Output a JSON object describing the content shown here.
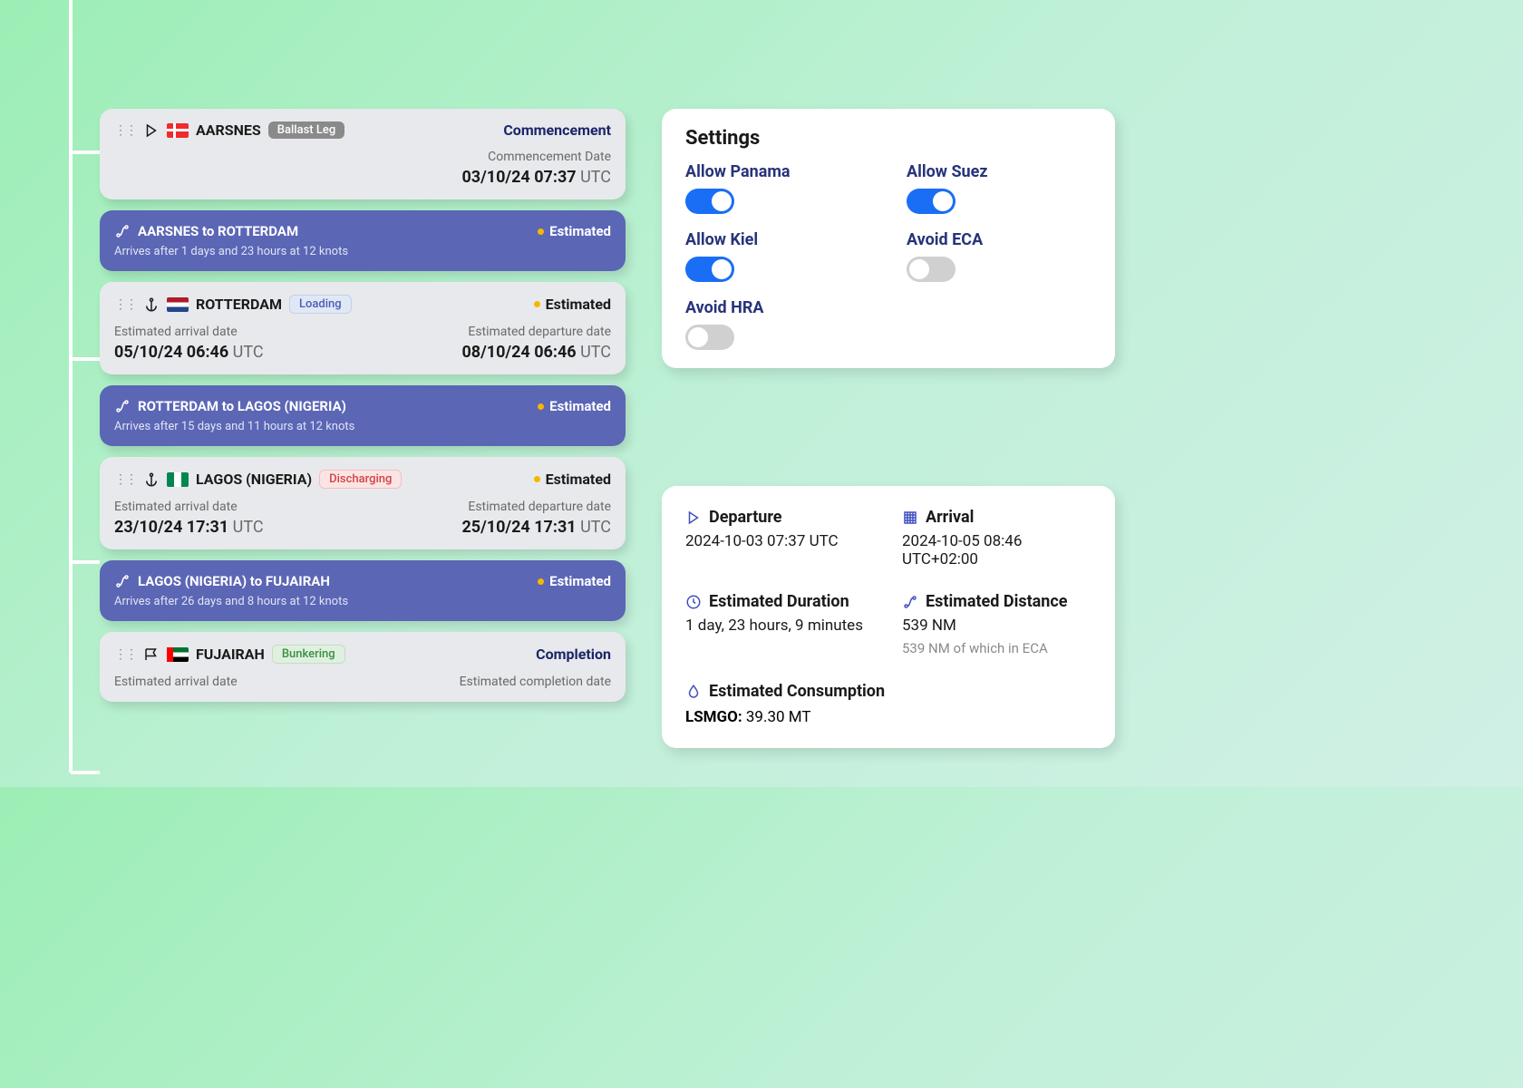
{
  "ports": [
    {
      "name": "AARSNES",
      "tag": "Ballast Leg",
      "tagClass": "tag-grey",
      "status": "Commencement",
      "dateLabel": "Commencement Date",
      "date": "03/10/24 07:37",
      "tz": "UTC"
    },
    {
      "name": "ROTTERDAM",
      "tag": "Loading",
      "tagClass": "tag-blue",
      "status": "Estimated",
      "arrLabel": "Estimated arrival date",
      "arr": "05/10/24 06:46",
      "arrTz": "UTC",
      "depLabel": "Estimated departure date",
      "dep": "08/10/24 06:46",
      "depTz": "UTC"
    },
    {
      "name": "LAGOS (NIGERIA)",
      "tag": "Discharging",
      "tagClass": "tag-red",
      "status": "Estimated",
      "arrLabel": "Estimated arrival date",
      "arr": "23/10/24 17:31",
      "arrTz": "UTC",
      "depLabel": "Estimated departure date",
      "dep": "25/10/24 17:31",
      "depTz": "UTC"
    },
    {
      "name": "FUJAIRAH",
      "tag": "Bunkering",
      "tagClass": "tag-green",
      "status": "Completion",
      "arrLabel": "Estimated arrival date",
      "depLabel": "Estimated completion date"
    }
  ],
  "legs": [
    {
      "title": "AARSNES to ROTTERDAM",
      "sub": "Arrives after 1 days and 23 hours at 12 knots",
      "status": "Estimated"
    },
    {
      "title": "ROTTERDAM to LAGOS (NIGERIA)",
      "sub": "Arrives after 15 days and 11 hours at 12 knots",
      "status": "Estimated"
    },
    {
      "title": "LAGOS (NIGERIA) to FUJAIRAH",
      "sub": "Arrives after 26 days and 8 hours at 12 knots",
      "status": "Estimated"
    }
  ],
  "settings": {
    "title": "Settings",
    "toggles": {
      "panama": {
        "label": "Allow Panama",
        "on": true
      },
      "suez": {
        "label": "Allow Suez",
        "on": true
      },
      "kiel": {
        "label": "Allow Kiel",
        "on": true
      },
      "eca": {
        "label": "Avoid ECA",
        "on": false
      },
      "hra": {
        "label": "Avoid HRA",
        "on": false
      }
    }
  },
  "summary": {
    "departure": {
      "label": "Departure",
      "value": "2024-10-03 07:37 UTC"
    },
    "arrival": {
      "label": "Arrival",
      "value": "2024-10-05 08:46 UTC+02:00"
    },
    "duration": {
      "label": "Estimated Duration",
      "value": "1 day, 23 hours, 9 minutes"
    },
    "distance": {
      "label": "Estimated Distance",
      "value": "539 NM",
      "sub": "539 NM of which in ECA"
    },
    "consumption": {
      "label": "Estimated Consumption",
      "fuel": "LSMGO:",
      "amount": "39.30 MT"
    }
  }
}
